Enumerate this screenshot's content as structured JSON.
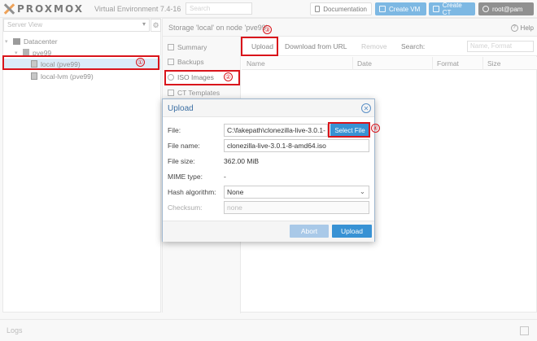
{
  "header": {
    "brand": "PROXMOX",
    "version": "Virtual Environment 7.4-16",
    "search_placeholder": "Search",
    "documentation_label": "Documentation",
    "create_vm_label": "Create VM",
    "create_ct_label": "Create CT",
    "user_label": "root@pam"
  },
  "sidebar": {
    "view_label": "Server View",
    "items": [
      {
        "label": "Datacenter"
      },
      {
        "label": "pve99"
      },
      {
        "label": "local (pve99)"
      },
      {
        "label": "local-lvm (pve99)"
      }
    ]
  },
  "main": {
    "title": "Storage 'local' on node 'pve99'",
    "help_label": "Help",
    "nav": [
      {
        "label": "Summary"
      },
      {
        "label": "Backups"
      },
      {
        "label": "ISO Images"
      },
      {
        "label": "CT Templates"
      }
    ],
    "toolbar": {
      "upload_label": "Upload",
      "download_label": "Download from URL",
      "remove_label": "Remove",
      "search_label": "Search:",
      "search_placeholder": "Name, Format"
    },
    "columns": [
      "Name",
      "Date",
      "Format",
      "Size"
    ]
  },
  "logs": {
    "label": "Logs"
  },
  "dialog": {
    "title": "Upload",
    "file_label": "File:",
    "file_value": "C:\\fakepath\\clonezilla-live-3.0.1-",
    "select_file_label": "Select File",
    "filename_label": "File name:",
    "filename_value": "clonezilla-live-3.0.1-8-amd64.iso",
    "filesize_label": "File size:",
    "filesize_value": "362.00 MiB",
    "mime_label": "MIME type:",
    "mime_value": "-",
    "hash_label": "Hash algorithm:",
    "hash_value": "None",
    "checksum_label": "Checksum:",
    "checksum_placeholder": "none",
    "abort_label": "Abort",
    "upload_label": "Upload"
  },
  "annotations": [
    "①",
    "②",
    "③",
    "④"
  ],
  "colors": {
    "accent": "#3892d4",
    "annotation": "#d9141b",
    "brand": "#e57000"
  }
}
